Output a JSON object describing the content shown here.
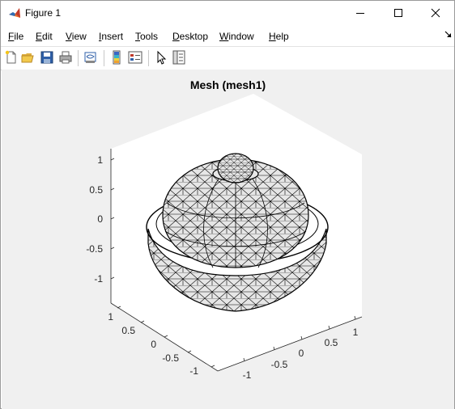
{
  "window": {
    "title": "Figure 1",
    "app_icon": "matlab-icon",
    "controls": [
      "minimize-icon",
      "maximize-icon",
      "close-icon"
    ]
  },
  "menu": {
    "file": {
      "first": "F",
      "rest": "ile"
    },
    "edit": {
      "first": "E",
      "rest": "dit"
    },
    "view": {
      "first": "V",
      "rest": "iew"
    },
    "insert": {
      "first": "I",
      "rest": "nsert"
    },
    "tools": {
      "first": "T",
      "rest": "ools"
    },
    "desktop": {
      "first": "D",
      "rest": "esktop"
    },
    "window": {
      "first": "W",
      "rest": "indow"
    },
    "help": {
      "first": "H",
      "rest": "elp"
    }
  },
  "toolbar": {
    "icons": [
      "new-figure-icon",
      "open-file-icon",
      "save-icon",
      "print-icon",
      "link-plot-icon",
      "insert-colorbar-icon",
      "insert-legend-icon",
      "edit-plot-icon",
      "property-inspector-icon"
    ]
  },
  "plot": {
    "title": "Mesh (mesh1)",
    "z_ticks": [
      "1",
      "0.5",
      "0",
      "-0.5",
      "-1"
    ],
    "x_ticks": [
      "1",
      "0.5",
      "0",
      "-0.5",
      "-1"
    ],
    "y_ticks": [
      "-1",
      "-0.5",
      "0",
      "0.5",
      "1"
    ],
    "colors": {
      "background": "#f0f0f0",
      "axes_face": "#ffffff",
      "mesh_face": "#e6e6e6",
      "edges": "#000000"
    }
  }
}
